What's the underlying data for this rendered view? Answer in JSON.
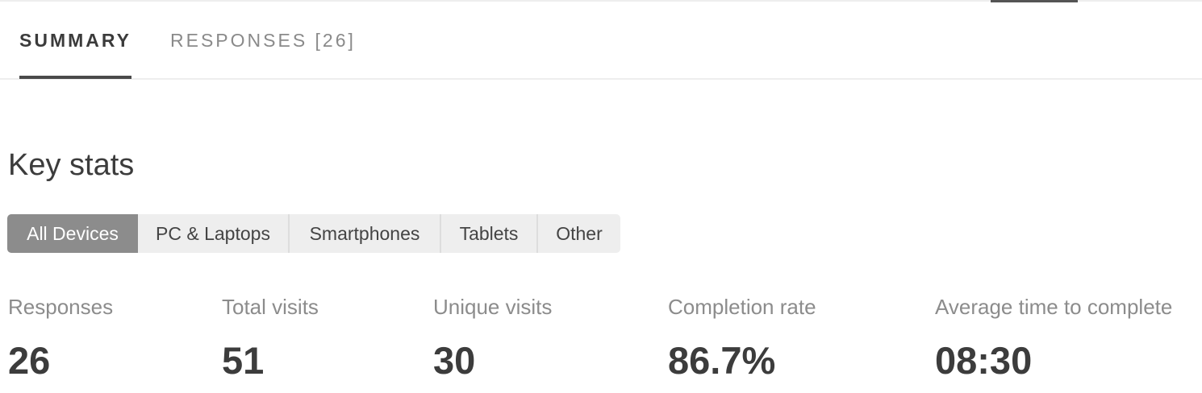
{
  "tabs": {
    "summary": "SUMMARY",
    "responses": "RESPONSES [26]"
  },
  "key_stats": {
    "title": "Key stats",
    "device_filter": {
      "options": [
        "All Devices",
        "PC & Laptops",
        "Smartphones",
        "Tablets",
        "Other"
      ],
      "selected": "All Devices"
    },
    "stats": [
      {
        "label": "Responses",
        "value": "26"
      },
      {
        "label": "Total visits",
        "value": "51"
      },
      {
        "label": "Unique visits",
        "value": "30"
      },
      {
        "label": "Completion rate",
        "value": "86.7%"
      },
      {
        "label": "Average time to complete",
        "value": "08:30"
      }
    ]
  },
  "colors": {
    "active_segment": "#8c8c8c",
    "segment_bg": "#eeeeee",
    "tab_indicator": "#4a4a4a",
    "label_gray": "#8c8c8c",
    "value_dark": "#3c3c3c"
  }
}
